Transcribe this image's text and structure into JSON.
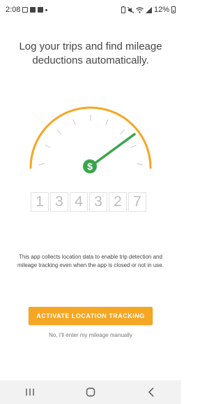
{
  "status_bar": {
    "time": "2:08",
    "battery": "12%",
    "left_icons": [
      "message-icon",
      "youtube-icon",
      "linkedin-icon",
      "dot-icon"
    ],
    "right_icons": [
      "battery-saver-icon",
      "mute-icon",
      "wifi-icon",
      "signal-icon",
      "battery-low-icon"
    ]
  },
  "headline": {
    "line1": "Log your trips and find mileage",
    "line2": "deductions automatically."
  },
  "gauge": {
    "icon_symbol": "$",
    "arc_color": "#f5a623",
    "needle_color": "#3aa54a"
  },
  "odometer": {
    "digits": [
      "1",
      "3",
      "4",
      "3",
      "2",
      "7"
    ]
  },
  "disclaimer": {
    "text": "This app collects location data to enable trip detection and mileage tracking even when the app is closed or not in use."
  },
  "cta": {
    "label": "ACTIVATE LOCATION TRACKING",
    "color": "#f5a623"
  },
  "manual_link": {
    "label": "No, I'll enter my mileage manually"
  },
  "nav": {
    "buttons": [
      "recent-apps-icon",
      "home-icon",
      "back-icon"
    ]
  }
}
